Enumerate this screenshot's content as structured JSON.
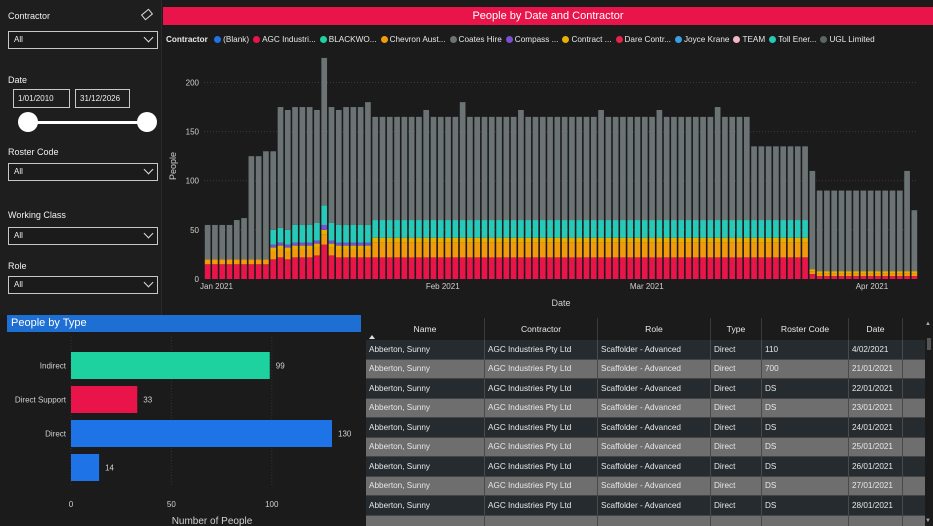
{
  "filters": {
    "contractor": {
      "label": "Contractor",
      "value": "All"
    },
    "date": {
      "label": "Date",
      "start": "1/01/2010",
      "end": "31/12/2026",
      "range_fraction": [
        0.0,
        1.0
      ]
    },
    "roster_code": {
      "label": "Roster Code",
      "value": "All"
    },
    "working_class": {
      "label": "Working Class",
      "value": "All"
    },
    "role": {
      "label": "Role",
      "value": "All"
    }
  },
  "main_chart": {
    "title": "People by Date and Contractor",
    "legend_title": "Contractor",
    "legend": [
      {
        "label": "(Blank)",
        "color": "#1e73e6"
      },
      {
        "label": "AGC Industri...",
        "color": "#e8144a"
      },
      {
        "label": "BLACKWO...",
        "color": "#1ed2a0"
      },
      {
        "label": "Chevron Aust...",
        "color": "#f09a0c"
      },
      {
        "label": "Coates Hire",
        "color": "#6c7374"
      },
      {
        "label": "Compass ...",
        "color": "#7b4fd3"
      },
      {
        "label": "Contract ...",
        "color": "#e6b000"
      },
      {
        "label": "Dare Contr...",
        "color": "#e8234a"
      },
      {
        "label": "Joyce Krane",
        "color": "#36a0e0"
      },
      {
        "label": "TEAM",
        "color": "#f4b6c2"
      },
      {
        "label": "Toll Ener...",
        "color": "#27c9b9"
      },
      {
        "label": "UGL Limited",
        "color": "#5c6465"
      }
    ]
  },
  "chart_data": [
    {
      "type": "bar",
      "title": "People by Date and Contractor",
      "xlabel": "Date",
      "ylabel": "People",
      "ylim": [
        0,
        230
      ],
      "yticks": [
        0,
        50,
        100,
        150,
        200
      ],
      "x_tick_labels": [
        {
          "label": "Jan 2021",
          "day": 0
        },
        {
          "label": "Feb 2021",
          "day": 31
        },
        {
          "label": "Mar 2021",
          "day": 59
        },
        {
          "label": "Apr 2021",
          "day": 90
        }
      ],
      "stacked": true,
      "legend": "top",
      "series_order": [
        "AGC Industri...",
        "Chevron Aust...",
        "Contract ...",
        "Compass ...",
        "BLACKWO...",
        "Coates Hire"
      ],
      "totals": [
        55,
        55,
        55,
        55,
        60,
        62,
        125,
        125,
        130,
        130,
        175,
        172,
        175,
        175,
        175,
        172,
        225,
        175,
        172,
        175,
        175,
        175,
        180,
        165,
        165,
        165,
        165,
        165,
        165,
        165,
        172,
        165,
        165,
        165,
        165,
        180,
        165,
        165,
        165,
        165,
        165,
        165,
        165,
        172,
        165,
        165,
        165,
        165,
        165,
        165,
        165,
        165,
        165,
        165,
        172,
        165,
        165,
        165,
        165,
        165,
        165,
        165,
        172,
        165,
        165,
        165,
        165,
        165,
        165,
        165,
        175,
        165,
        165,
        165,
        165,
        135,
        135,
        135,
        135,
        135,
        135,
        135,
        135,
        110,
        90,
        90,
        90,
        90,
        90,
        90,
        90,
        90,
        90,
        90,
        90,
        90,
        110,
        70
      ],
      "agc": [
        15,
        15,
        15,
        15,
        15,
        15,
        15,
        15,
        15,
        20,
        22,
        20,
        22,
        22,
        22,
        24,
        35,
        24,
        22,
        22,
        22,
        22,
        22,
        22,
        22,
        22,
        22,
        22,
        22,
        22,
        22,
        22,
        22,
        22,
        22,
        22,
        22,
        22,
        22,
        22,
        22,
        22,
        22,
        22,
        22,
        22,
        22,
        22,
        22,
        22,
        22,
        22,
        22,
        22,
        22,
        22,
        22,
        22,
        22,
        22,
        22,
        22,
        22,
        22,
        22,
        22,
        22,
        22,
        22,
        22,
        22,
        22,
        22,
        22,
        22,
        22,
        22,
        22,
        22,
        22,
        22,
        22,
        22,
        5,
        3,
        3,
        3,
        3,
        3,
        3,
        3,
        3,
        3,
        3,
        3,
        3,
        3,
        3
      ],
      "orange": [
        5,
        5,
        5,
        5,
        5,
        5,
        5,
        5,
        5,
        8,
        8,
        8,
        8,
        8,
        8,
        8,
        10,
        8,
        8,
        8,
        8,
        8,
        8,
        15,
        15,
        15,
        15,
        15,
        15,
        15,
        15,
        15,
        15,
        15,
        15,
        15,
        15,
        15,
        15,
        15,
        15,
        15,
        15,
        15,
        15,
        15,
        15,
        15,
        15,
        15,
        15,
        15,
        15,
        15,
        15,
        15,
        15,
        15,
        15,
        15,
        15,
        15,
        15,
        15,
        15,
        15,
        15,
        15,
        15,
        15,
        15,
        15,
        15,
        15,
        15,
        15,
        15,
        15,
        15,
        15,
        15,
        15,
        15,
        3,
        3,
        3,
        3,
        3,
        3,
        3,
        3,
        3,
        3,
        3,
        3,
        3,
        3,
        3
      ],
      "yellow": [
        0,
        0,
        0,
        0,
        0,
        0,
        0,
        0,
        0,
        4,
        4,
        4,
        4,
        4,
        4,
        4,
        5,
        4,
        4,
        4,
        4,
        4,
        4,
        5,
        5,
        5,
        5,
        5,
        5,
        5,
        5,
        5,
        5,
        5,
        5,
        5,
        5,
        5,
        5,
        5,
        5,
        5,
        5,
        5,
        5,
        5,
        5,
        5,
        5,
        5,
        5,
        5,
        5,
        5,
        5,
        5,
        5,
        5,
        5,
        5,
        5,
        5,
        5,
        5,
        5,
        5,
        5,
        5,
        5,
        5,
        5,
        5,
        5,
        5,
        5,
        5,
        5,
        5,
        5,
        5,
        5,
        5,
        5,
        2,
        2,
        2,
        2,
        2,
        2,
        2,
        2,
        2,
        2,
        2,
        2,
        2,
        2,
        2
      ],
      "purple": [
        0,
        0,
        0,
        0,
        0,
        0,
        0,
        0,
        0,
        3,
        3,
        3,
        3,
        3,
        3,
        3,
        5,
        3,
        3,
        3,
        3,
        3,
        3,
        0,
        0,
        0,
        0,
        0,
        0,
        0,
        0,
        0,
        0,
        0,
        0,
        0,
        0,
        0,
        0,
        0,
        0,
        0,
        0,
        0,
        0,
        0,
        0,
        0,
        0,
        0,
        0,
        0,
        0,
        0,
        0,
        0,
        0,
        0,
        0,
        0,
        0,
        0,
        0,
        0,
        0,
        0,
        0,
        0,
        0,
        0,
        0,
        0,
        0,
        0,
        0,
        0,
        0,
        0,
        0,
        0,
        0,
        0,
        0,
        0,
        0,
        0,
        0,
        0,
        0,
        0,
        0,
        0,
        0,
        0,
        0,
        0,
        0,
        0
      ],
      "teal": [
        0,
        0,
        0,
        0,
        0,
        0,
        0,
        0,
        0,
        15,
        15,
        15,
        18,
        18,
        18,
        18,
        20,
        18,
        18,
        18,
        18,
        18,
        18,
        18,
        18,
        18,
        18,
        18,
        18,
        18,
        18,
        18,
        18,
        18,
        18,
        18,
        18,
        18,
        18,
        18,
        18,
        18,
        18,
        18,
        18,
        18,
        18,
        18,
        18,
        18,
        18,
        18,
        18,
        18,
        18,
        18,
        18,
        18,
        18,
        18,
        18,
        18,
        18,
        18,
        18,
        18,
        18,
        18,
        18,
        18,
        18,
        18,
        18,
        18,
        18,
        18,
        18,
        18,
        18,
        18,
        18,
        18,
        18,
        0,
        0,
        0,
        0,
        0,
        0,
        0,
        0,
        0,
        0,
        0,
        0,
        0,
        0,
        0
      ]
    },
    {
      "type": "bar",
      "orientation": "horizontal",
      "title": "People by Type",
      "xlabel": "Number of People",
      "ylabel": "",
      "xlim": [
        0,
        130
      ],
      "xticks": [
        0,
        50,
        100
      ],
      "categories": [
        "Indirect",
        "Direct Support",
        "Direct",
        ""
      ],
      "values": [
        99,
        33,
        130,
        14
      ],
      "colors": [
        "#1ed2a0",
        "#e8144a",
        "#1e73e6",
        "#1e73e6"
      ]
    }
  ],
  "table": {
    "columns": [
      "Name",
      "Contractor",
      "Role",
      "Type",
      "Roster Code",
      "Date"
    ],
    "rows": [
      [
        "Abberton, Sunny",
        "AGC Industries Pty Ltd",
        "Scaffolder - Advanced",
        "Direct",
        "110",
        "4/02/2021"
      ],
      [
        "Abberton, Sunny",
        "AGC Industries Pty Ltd",
        "Scaffolder - Advanced",
        "Direct",
        "700",
        "21/01/2021"
      ],
      [
        "Abberton, Sunny",
        "AGC Industries Pty Ltd",
        "Scaffolder - Advanced",
        "Direct",
        "DS",
        "22/01/2021"
      ],
      [
        "Abberton, Sunny",
        "AGC Industries Pty Ltd",
        "Scaffolder - Advanced",
        "Direct",
        "DS",
        "23/01/2021"
      ],
      [
        "Abberton, Sunny",
        "AGC Industries Pty Ltd",
        "Scaffolder - Advanced",
        "Direct",
        "DS",
        "24/01/2021"
      ],
      [
        "Abberton, Sunny",
        "AGC Industries Pty Ltd",
        "Scaffolder - Advanced",
        "Direct",
        "DS",
        "25/01/2021"
      ],
      [
        "Abberton, Sunny",
        "AGC Industries Pty Ltd",
        "Scaffolder - Advanced",
        "Direct",
        "DS",
        "26/01/2021"
      ],
      [
        "Abberton, Sunny",
        "AGC Industries Pty Ltd",
        "Scaffolder - Advanced",
        "Direct",
        "DS",
        "27/01/2021"
      ],
      [
        "Abberton, Sunny",
        "AGC Industries Pty Ltd",
        "Scaffolder - Advanced",
        "Direct",
        "DS",
        "28/01/2021"
      ],
      [
        "",
        "",
        "",
        "",
        "",
        ""
      ]
    ]
  },
  "type_panel": {
    "title": "People by Type"
  }
}
